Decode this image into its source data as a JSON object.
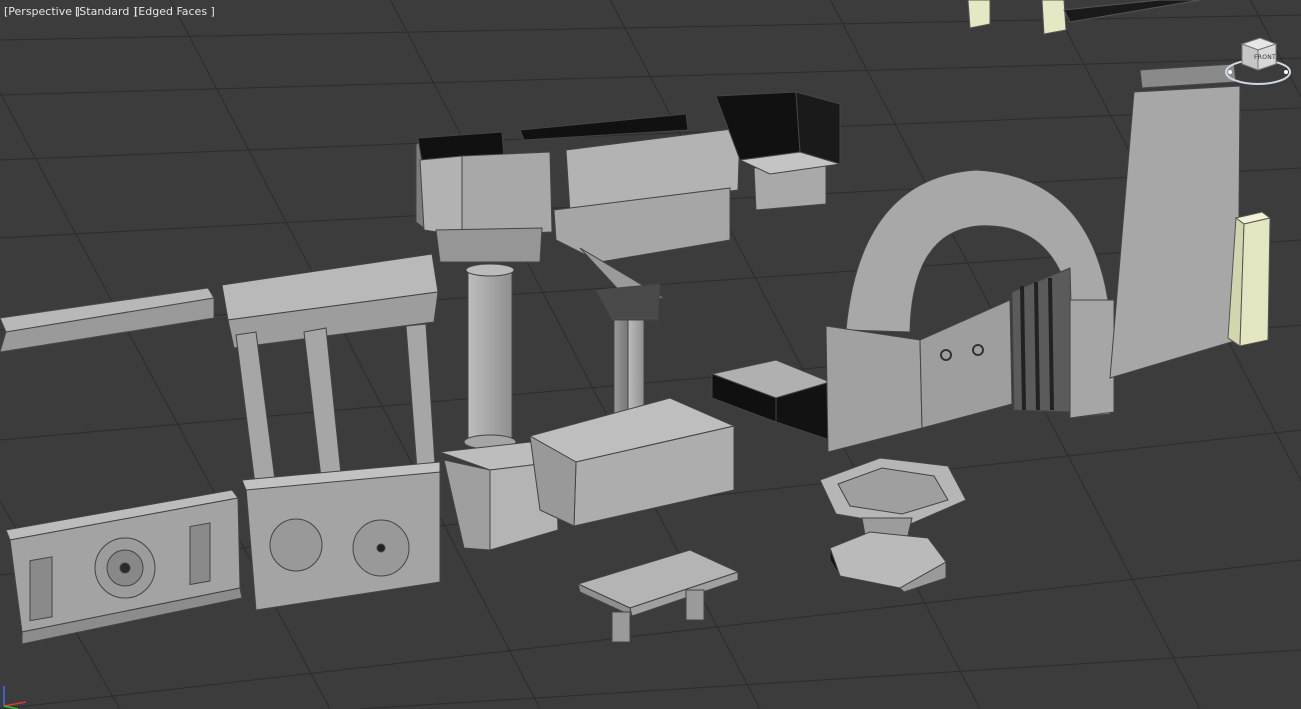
{
  "viewport": {
    "view_label": "[Perspective ]",
    "shading_label": "[Standard ]",
    "display_label": "[Edged Faces ]"
  },
  "viewcube": {
    "face_label": "FRONT",
    "icon": "viewcube-icon"
  },
  "axis_tripod": {
    "icon": "axis-tripod-icon"
  },
  "colors": {
    "background": "#3c3c3c",
    "grid": "#2e2e2e",
    "model_fill": "#a9a9a9",
    "model_edge": "#4a4a4a",
    "selected_fill": "#e6e8c4",
    "ui_text": "#e6e6e6"
  }
}
